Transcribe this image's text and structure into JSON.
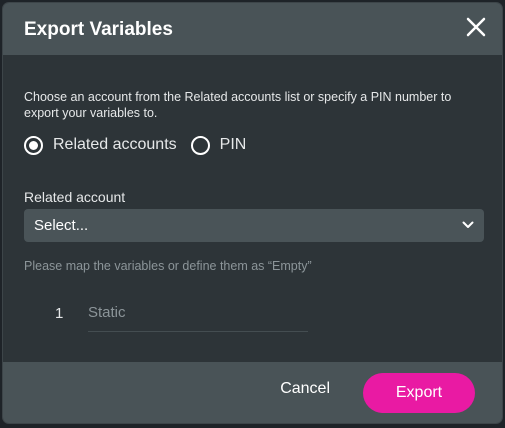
{
  "dialog": {
    "title": "Export Variables",
    "close_icon": "close-icon"
  },
  "body": {
    "description": "Choose an account from the Related accounts list or specify a PIN number to export your variables to.",
    "radios": [
      {
        "label": "Related accounts",
        "selected": true
      },
      {
        "label": "PIN",
        "selected": false
      }
    ],
    "related_account_label": "Related account",
    "select_value": "Select...",
    "hint": "Please map the variables or define them as “Empty”",
    "mappings": [
      {
        "index": "1",
        "placeholder": "Static"
      }
    ]
  },
  "footer": {
    "cancel_label": "Cancel",
    "export_label": "Export"
  },
  "colors": {
    "header_bg": "#495357",
    "dialog_bg": "#2d3438",
    "accent": "#e91aa3",
    "select_bg": "#4a5458"
  }
}
